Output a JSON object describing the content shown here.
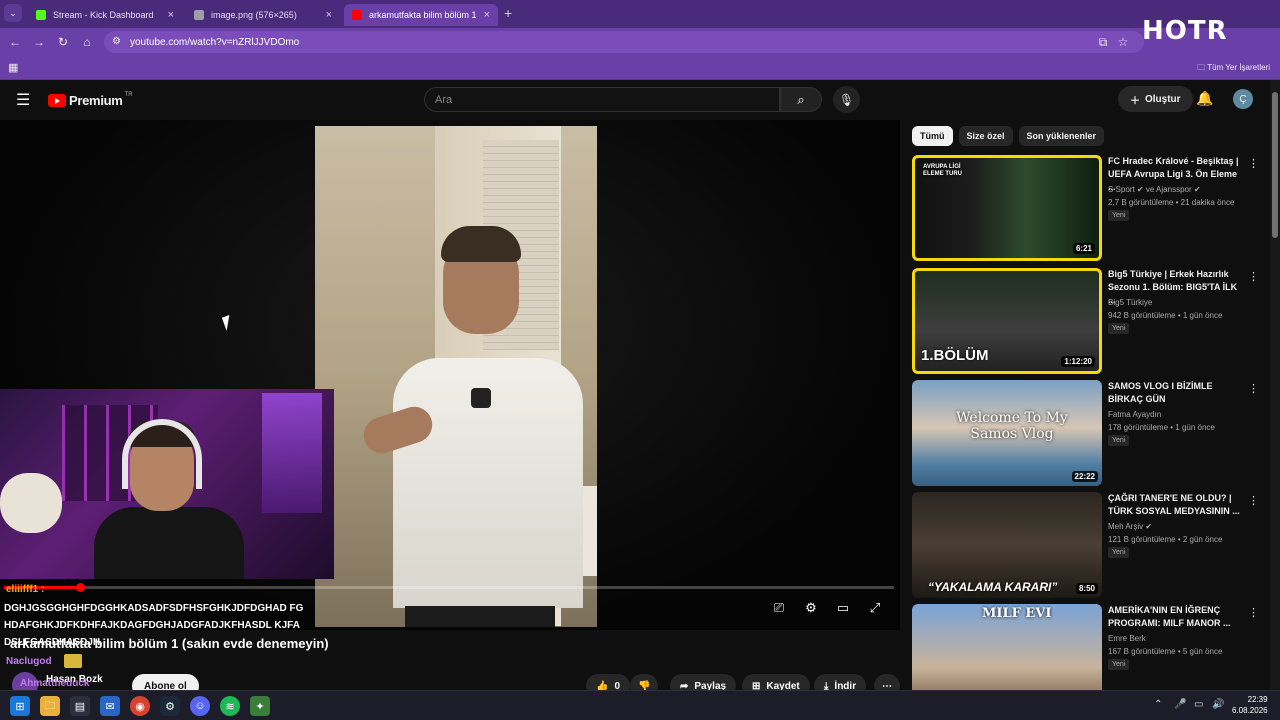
{
  "browser": {
    "tabs": [
      {
        "title": "Stream - Kick Dashboard",
        "favicon_color": "#53fc18"
      },
      {
        "title": "image.png (576×265)",
        "favicon_color": "#9aa0a6"
      },
      {
        "title": "arkamutfakta bilim bölüm 1 (sa",
        "favicon_color": "#ff0000"
      }
    ],
    "url": "youtube.com/watch?v=nZRlJJVDOmo",
    "bookmarks_all": "Tüm Yer İşaretleri",
    "overlay_logo": "HOTR"
  },
  "youtube": {
    "logo_text": "Premium",
    "logo_sup": "TR",
    "search_placeholder": "Ara",
    "create_label": "Oluştur",
    "avatar_letter": "Ç"
  },
  "player": {
    "progress_fraction": 0.085,
    "title": "arkamutfakta bilim bölüm 1 (sakın evde denemeyin)",
    "channel": "Hasan Bozk",
    "subscribe": "Abone ol",
    "actions": {
      "like_count": "0",
      "share": "Paylaş",
      "save": "Kaydet",
      "download": "İndir"
    }
  },
  "chat": {
    "user1": "eliiifff1 :",
    "message1": "DGHJGSGGHGHFDGGHKADSADFSDFHSFGHKJDFDGHAD FGHDAFGHKJDFKDHFAJKDAGFDGHJADGFADJKFHASDL KJFADSLFGASDHASDJH",
    "user2": "Naclugod",
    "user3": "Ahmattheduck"
  },
  "sidebar": {
    "chips": [
      "Tümü",
      "Size özel",
      "Son yüklenenler"
    ],
    "recommendations": [
      {
        "title": "FC Hradec Králové - Beşiktaş | UEFA Avrupa Ligi 3. Ön Eleme ...",
        "channel": "S Sport ✔ ve Ajansspor ✔",
        "meta": "2,7 B görüntüleme • 21 dakika önce",
        "badge": "Yeni",
        "duration": "6:21",
        "thumb_text": "AVRUPA LİGİ ELEME TURU"
      },
      {
        "title": "Big5 Türkiye | Erkek Hazırlık Sezonu 1. Bölüm: BIG5'TA İLK ...",
        "channel": "Big5 Türkiye",
        "meta": "942 B görüntüleme • 1 gün önce",
        "badge": "Yeni",
        "duration": "1:12:20",
        "thumb_text": "1.BÖLÜM"
      },
      {
        "title": "SAMOS VLOG I BİZİMLE BİRKAÇ GÜN",
        "channel": "Fatma Ayaydın",
        "meta": "178 görüntüleme • 1 gün önce",
        "badge": "Yeni",
        "duration": "22:22",
        "thumb_text": "Welcome To My Samos Vlog"
      },
      {
        "title": "ÇAĞRI TANER'E NE OLDU? | TÜRK SOSYAL MEDYASININ ...",
        "channel": "Meh Arşiv ✔",
        "meta": "121 B görüntüleme • 2 gün önce",
        "badge": "Yeni",
        "duration": "8:50",
        "thumb_text": "“YAKALAMA KARARI”"
      },
      {
        "title": "AMERİKA'NIN EN İĞRENÇ PROGRAMI: MILF MANOR ...",
        "channel": "Emre Berk",
        "meta": "167 B görüntüleme • 5 gün önce",
        "badge": "Yeni",
        "duration": "",
        "thumb_text": "MILF EVI"
      }
    ]
  },
  "taskbar": {
    "time": "22:39",
    "date": "6.08.2026"
  },
  "colors": {
    "brand_red": "#ff0000",
    "highlight_yellow": "#f5d90a",
    "browser_purple": "#6a3fa8"
  }
}
